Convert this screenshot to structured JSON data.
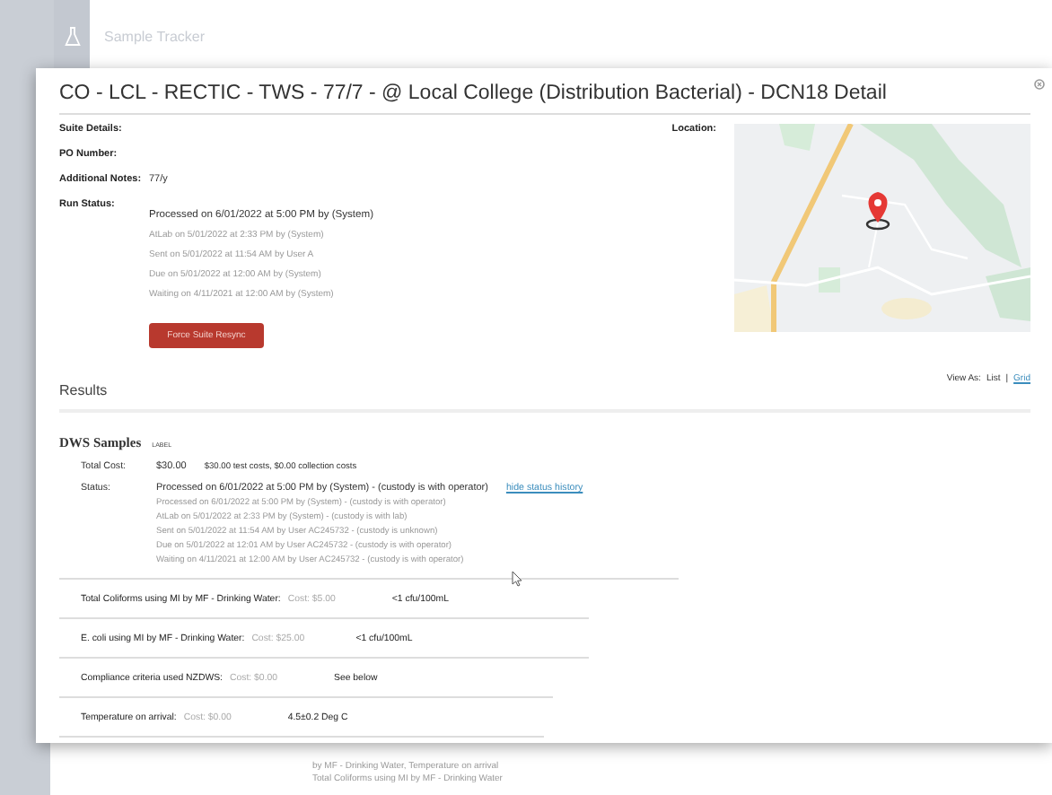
{
  "app_header": {
    "title": "Sample Tracker"
  },
  "modal": {
    "title": "CO - LCL - RECTIC - TWS - 77/7 - @ Local College (Distribution Bacterial) - DCN18 Detail",
    "fields": [
      {
        "label": "Suite Details:"
      },
      {
        "label": "PO Number:"
      },
      {
        "label": "Additional Notes:",
        "value": "77/y"
      }
    ],
    "run_status": {
      "label": "Run Status:",
      "current": "Processed on 6/01/2022 at 5:00 PM by (System)",
      "history": [
        "AtLab on 5/01/2022 at 2:33 PM by (System)",
        "Sent on 5/01/2022 at 11:54 AM by User A",
        "Due on 5/01/2022 at 12:00 AM by (System)",
        "Waiting on 4/11/2021 at 12:00 AM by (System)"
      ]
    },
    "resync_button": "Force Suite Resync",
    "location_label": "Location:",
    "results_title": "Results",
    "view_as": {
      "label": "View As:",
      "separator": "|",
      "options": [
        {
          "label": "List",
          "selected": true
        },
        {
          "label": "Grid",
          "selected": false
        }
      ]
    },
    "samples": {
      "title": "DWS Samples",
      "tag": "LABEL",
      "total_cost_label": "Total Cost:",
      "total_cost": "$30.00",
      "cost_detail": "$30.00 test costs, $0.00 collection costs",
      "status_label": "Status:",
      "status": "Processed on 6/01/2022 at 5:00 PM by (System) - (custody is with operator)",
      "status_link": "hide status history",
      "status_history": [
        "Processed on 6/01/2022 at 5:00 PM by (System) - (custody is with operator)",
        "AtLab on 5/01/2022 at 2:33 PM by (System) - (custody is with lab)",
        "Sent on 5/01/2022 at 11:54 AM by User AC245732 - (custody is unknown)",
        "Due on 5/01/2022 at 12:01 AM by User AC245732 - (custody is with operator)",
        "Waiting on 4/11/2021 at 12:00 AM by User AC245732 - (custody is with operator)"
      ],
      "tests": [
        {
          "name": "Total Coliforms using MI by MF - Drinking Water:",
          "cost": "Cost: $5.00",
          "result": "<1 cfu/100mL"
        },
        {
          "name": "E. coli using MI by MF - Drinking Water:",
          "cost": "Cost: $25.00",
          "result": "<1 cfu/100mL"
        },
        {
          "name": "Compliance criteria used NZDWS:",
          "cost": "Cost: $0.00",
          "result": "See below"
        },
        {
          "name": "Temperature on arrival:",
          "cost": "Cost: $0.00",
          "result": "4.5±0.2 Deg C"
        }
      ]
    }
  },
  "background_row": {
    "lines": [
      "by MF - Drinking Water, Temperature on arrival",
      "Total Coliforms using MI by MF - Drinking Water"
    ]
  }
}
